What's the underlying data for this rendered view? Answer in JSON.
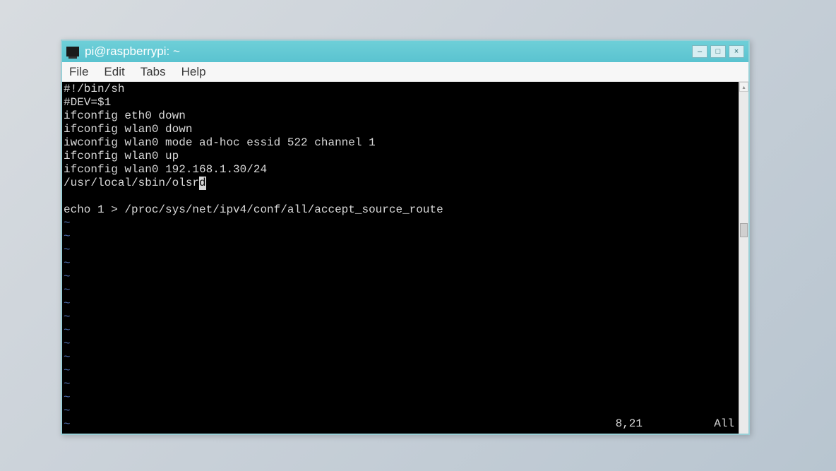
{
  "window": {
    "title": "pi@raspberrypi: ~"
  },
  "menubar": {
    "items": [
      "File",
      "Edit",
      "Tabs",
      "Help"
    ]
  },
  "terminal": {
    "lines": [
      "#!/bin/sh",
      "#DEV=$1",
      "ifconfig eth0 down",
      "ifconfig wlan0 down",
      "iwconfig wlan0 mode ad-hoc essid 522 channel 1",
      "ifconfig wlan0 up",
      "ifconfig wlan0 192.168.1.30/24"
    ],
    "cursor_line_prefix": "/usr/local/sbin/olsr",
    "cursor_char": "d",
    "after_blank": "echo 1 > /proc/sys/net/ipv4/conf/all/accept_source_route",
    "tilde_count": 16,
    "status": {
      "pos": "8,21",
      "scroll": "All"
    }
  }
}
